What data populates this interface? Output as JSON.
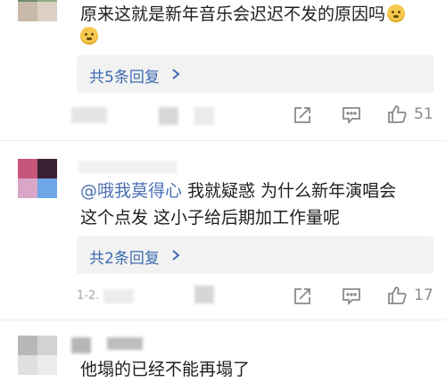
{
  "comments": [
    {
      "text": "原来这就是新年音乐会迟迟不发的原因吗",
      "reply_label": "共5条回复",
      "like_count": "51",
      "avatar_colors": [
        "#6d8f6a",
        "#8fae88",
        "#c9b9a8",
        "#dcd0c4"
      ]
    },
    {
      "mention": "@哦我莫得心",
      "text_line1": " 我就疑惑 为什么新年演唱会",
      "text_line2": "这个点发 这小子给后期加工作量呢",
      "reply_label": "共2条回复",
      "like_count": "17",
      "date_fragment": "1-2.",
      "avatar_colors": [
        "#c7577a",
        "#3b2233",
        "#d9a6c8",
        "#6fa6e8"
      ]
    },
    {
      "text": "他塌的已经不能再塌了",
      "avatar_colors": [
        "#b8b8b8",
        "#d2d2d2",
        "#e0e0e0",
        "#ececec"
      ]
    }
  ],
  "icons": {
    "chevron": "chevron-right-icon",
    "share": "share-icon",
    "comment": "comment-icon",
    "like": "thumbs-up-icon",
    "emoji": "sweat-smile-emoji-icon"
  },
  "colors": {
    "link": "#3d6bb0",
    "mention": "#4a6fb3",
    "reply_bg": "#f2f2f2",
    "icon_gray": "#8a8a8a"
  }
}
